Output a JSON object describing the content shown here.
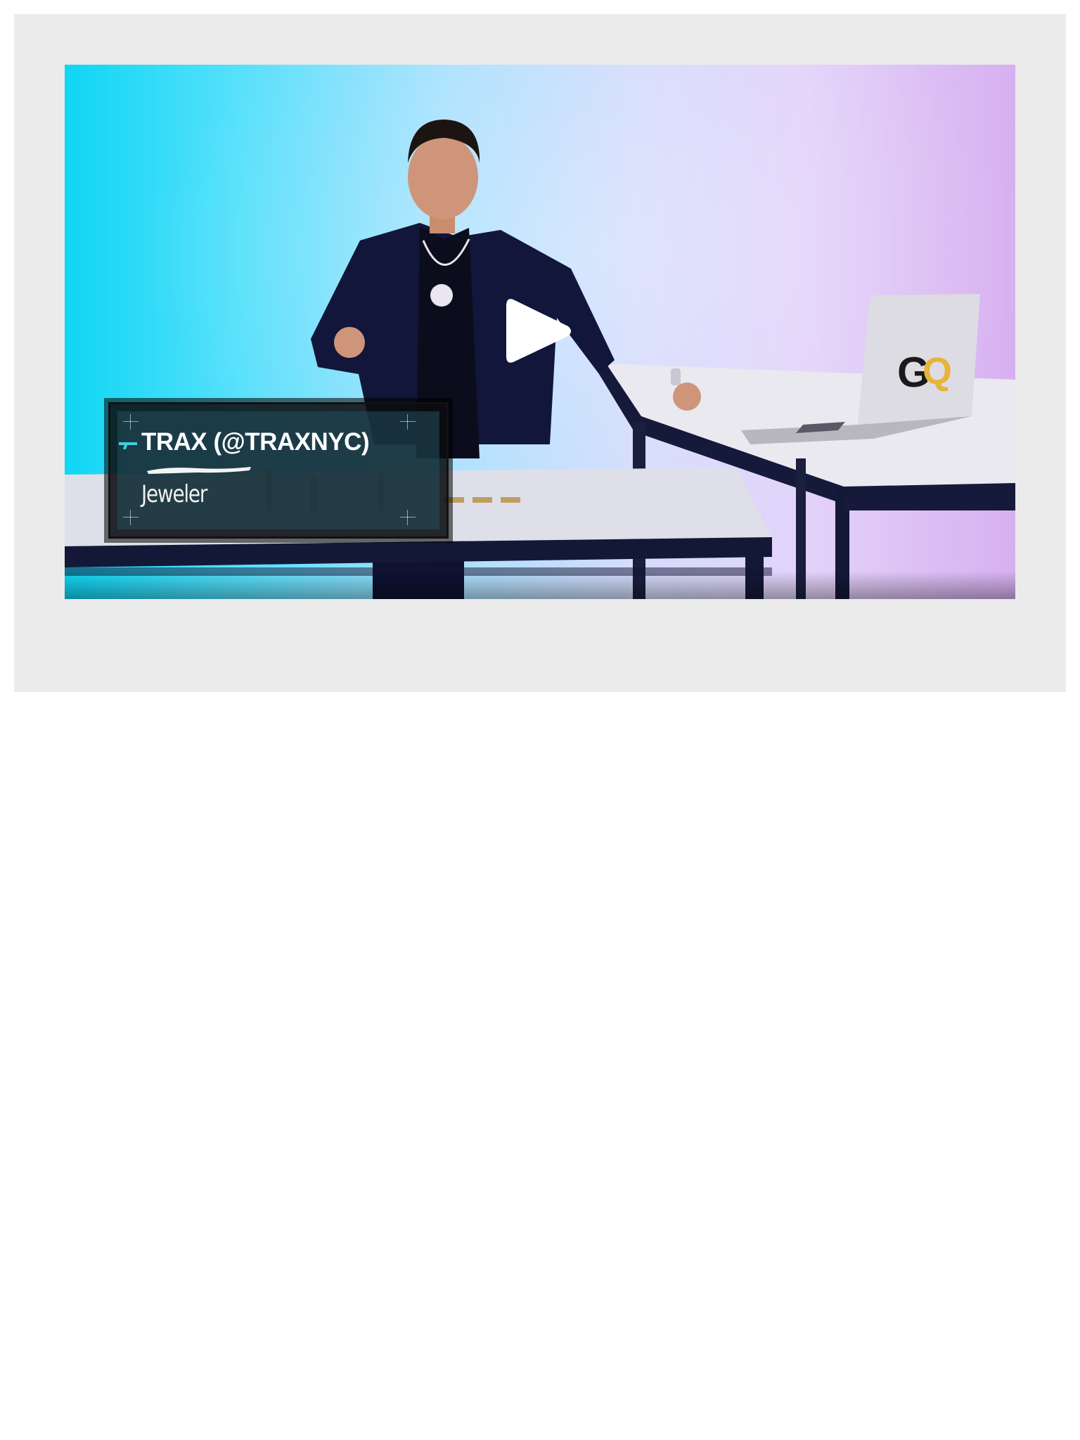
{
  "video": {
    "lower_third": {
      "name": "TRAX (@TRAXNYC)",
      "title": "Jeweler"
    },
    "brand_logo_text": "GQ",
    "play_icon": "play-icon",
    "colors": {
      "card_background": "#ebebeb",
      "backdrop_left": "#0fd6f4",
      "backdrop_right": "#d7b0f0",
      "accent": "#3fd0e0",
      "logo_gold": "#e6b43a"
    }
  }
}
